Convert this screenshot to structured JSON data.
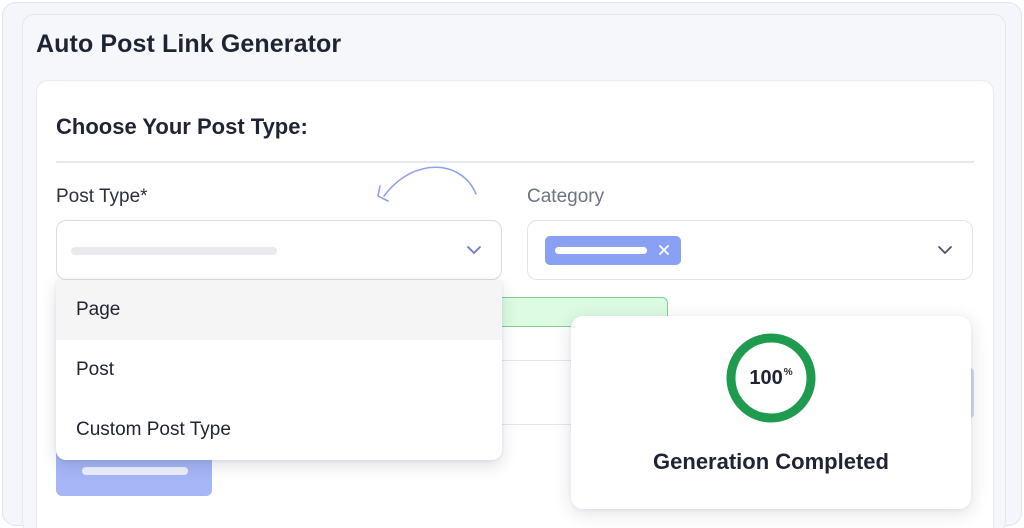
{
  "app": {
    "title": "Auto Post Link Generator"
  },
  "form": {
    "section_title": "Choose Your Post Type:",
    "post_type": {
      "label": "Post Type*",
      "icon": "chevron-down-icon"
    },
    "category": {
      "label": "Category",
      "icon": "chevron-down-icon",
      "tag_close_icon": "close-icon"
    }
  },
  "dropdown": {
    "options": [
      {
        "label": "Page",
        "highlighted": true
      },
      {
        "label": "Post",
        "highlighted": false
      },
      {
        "label": "Custom Post Type",
        "highlighted": false
      }
    ]
  },
  "progress": {
    "value": "100",
    "unit": "%",
    "percent": 100,
    "status": "Generation Completed"
  },
  "colors": {
    "accent_blue": "#8aa0f3",
    "progress_green": "#1f9b4f",
    "success_bg": "#dcfbe2"
  }
}
